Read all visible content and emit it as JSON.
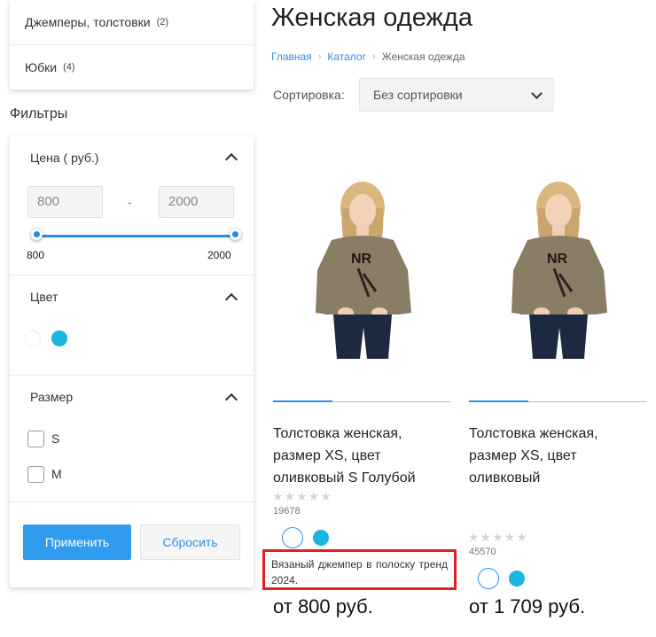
{
  "categories": [
    {
      "label": "Джемперы, толстовки",
      "count": "(2)"
    },
    {
      "label": "Юбки",
      "count": "(4)"
    }
  ],
  "filters": {
    "title": "Фильтры",
    "price": {
      "heading": "Цена ( руб.)",
      "min_value": "800",
      "max_value": "2000",
      "separator": "-",
      "range_min_label": "800",
      "range_max_label": "2000"
    },
    "color": {
      "heading": "Цвет",
      "swatches": [
        "#ffffff",
        "#19b6dd"
      ]
    },
    "size": {
      "heading": "Размер",
      "options": [
        "S",
        "M"
      ]
    },
    "apply_label": "Применить",
    "reset_label": "Сбросить"
  },
  "page": {
    "title": "Женская одежда",
    "breadcrumb": [
      "Главная",
      "Каталог",
      "Женская одежда"
    ],
    "breadcrumb_separator": "›"
  },
  "sort": {
    "label": "Сортировка:",
    "selected": "Без сортировки"
  },
  "products": [
    {
      "title": "Толстовка женская, размер XS, цвет оливковый S Голубой",
      "stars": "★★★★★",
      "code": "19678",
      "description": "Вязаный джемпер в полоску тренд 2024.",
      "price": "от 800 руб."
    },
    {
      "title": "Толстовка женская, размер XS, цвет оливковый",
      "stars": "★★★★★",
      "code": "45570",
      "price": "от 1 709 руб."
    }
  ],
  "colors": {
    "accent": "#2f9cf0",
    "swatch_blue": "#19b6dd",
    "highlight_border": "#e02020",
    "sweater": "#8a7d66",
    "jeans": "#1c2940"
  }
}
